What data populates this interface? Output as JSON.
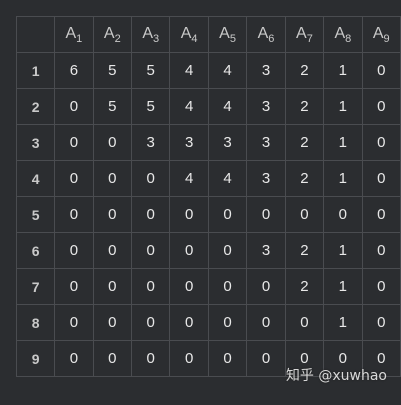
{
  "table": {
    "column_headers": [
      {
        "base": "A",
        "sub": "1"
      },
      {
        "base": "A",
        "sub": "2"
      },
      {
        "base": "A",
        "sub": "3"
      },
      {
        "base": "A",
        "sub": "4"
      },
      {
        "base": "A",
        "sub": "5"
      },
      {
        "base": "A",
        "sub": "6"
      },
      {
        "base": "A",
        "sub": "7"
      },
      {
        "base": "A",
        "sub": "8"
      },
      {
        "base": "A",
        "sub": "9"
      }
    ],
    "rows": [
      {
        "label": "1",
        "cells": [
          "6",
          "5",
          "5",
          "4",
          "4",
          "3",
          "2",
          "1",
          "0"
        ]
      },
      {
        "label": "2",
        "cells": [
          "0",
          "5",
          "5",
          "4",
          "4",
          "3",
          "2",
          "1",
          "0"
        ]
      },
      {
        "label": "3",
        "cells": [
          "0",
          "0",
          "3",
          "3",
          "3",
          "3",
          "2",
          "1",
          "0"
        ]
      },
      {
        "label": "4",
        "cells": [
          "0",
          "0",
          "0",
          "4",
          "4",
          "3",
          "2",
          "1",
          "0"
        ]
      },
      {
        "label": "5",
        "cells": [
          "0",
          "0",
          "0",
          "0",
          "0",
          "0",
          "0",
          "0",
          "0"
        ]
      },
      {
        "label": "6",
        "cells": [
          "0",
          "0",
          "0",
          "0",
          "0",
          "3",
          "2",
          "1",
          "0"
        ]
      },
      {
        "label": "7",
        "cells": [
          "0",
          "0",
          "0",
          "0",
          "0",
          "0",
          "2",
          "1",
          "0"
        ]
      },
      {
        "label": "8",
        "cells": [
          "0",
          "0",
          "0",
          "0",
          "0",
          "0",
          "0",
          "1",
          "0"
        ]
      },
      {
        "label": "9",
        "cells": [
          "0",
          "0",
          "0",
          "0",
          "0",
          "0",
          "0",
          "0",
          "0"
        ]
      }
    ]
  },
  "watermark": "知乎 @xuwhao",
  "colors": {
    "background": "#2b2d30",
    "grid_line": "#4a4c50",
    "cell_text": "#e8e8e8",
    "header_text": "#c9c9c9"
  }
}
